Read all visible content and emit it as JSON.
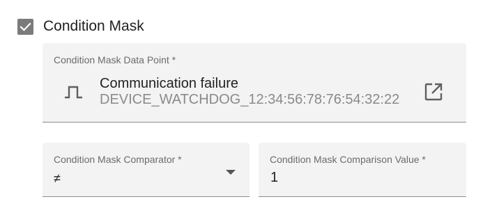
{
  "condition_mask": {
    "checked": true,
    "label": "Condition Mask"
  },
  "data_point_field": {
    "label": "Condition Mask Data Point *",
    "name": "Communication failure",
    "id": "DEVICE_WATCHDOG_12:34:56:78:76:54:32:22",
    "icon": "digital-signal-icon",
    "action_icon": "open-in-new-icon"
  },
  "comparator_field": {
    "label": "Condition Mask Comparator *",
    "value": "≠",
    "icon": "dropdown-arrow-icon"
  },
  "comparison_value_field": {
    "label": "Condition Mask Comparison Value *",
    "value": "1"
  },
  "colors": {
    "checkbox": "#7b7b7b",
    "field_background": "#f3f3f3",
    "text_primary": "#212121",
    "text_secondary": "#6b6b6b"
  }
}
